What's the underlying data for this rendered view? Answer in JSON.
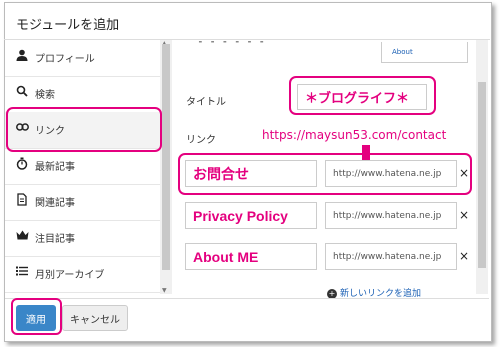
{
  "dialog": {
    "title": "モジュールを追加"
  },
  "sidebar": {
    "items": [
      {
        "label": "プロフィール",
        "icon": "person-icon"
      },
      {
        "label": "検索",
        "icon": "search-icon"
      },
      {
        "label": "リンク",
        "icon": "link-icon"
      },
      {
        "label": "最新記事",
        "icon": "stopwatch-icon"
      },
      {
        "label": "関連記事",
        "icon": "document-icon"
      },
      {
        "label": "注目記事",
        "icon": "crown-icon"
      },
      {
        "label": "月別アーカイブ",
        "icon": "list-icon"
      }
    ]
  },
  "main": {
    "about_url_partial": "About",
    "title_label": "タイトル",
    "title_value": "＊ブログライフ＊",
    "links_label": "リンク",
    "annotation": "https://maysun53.com/contact",
    "links": [
      {
        "name": "お問合せ",
        "url": "http://www.hatena.ne.jp"
      },
      {
        "name": "Privacy Policy",
        "url": "http://www.hatena.ne.jp"
      },
      {
        "name": "About ME",
        "url": "http://www.hatena.ne.jp"
      }
    ],
    "remove_symbol": "×",
    "add_link": "新しいリンクを追加"
  },
  "footer": {
    "apply": "適用",
    "cancel": "キャンセル"
  },
  "colors": {
    "highlight": "#e4007f",
    "primary": "#3a86c8",
    "link": "#1a5fb4"
  }
}
